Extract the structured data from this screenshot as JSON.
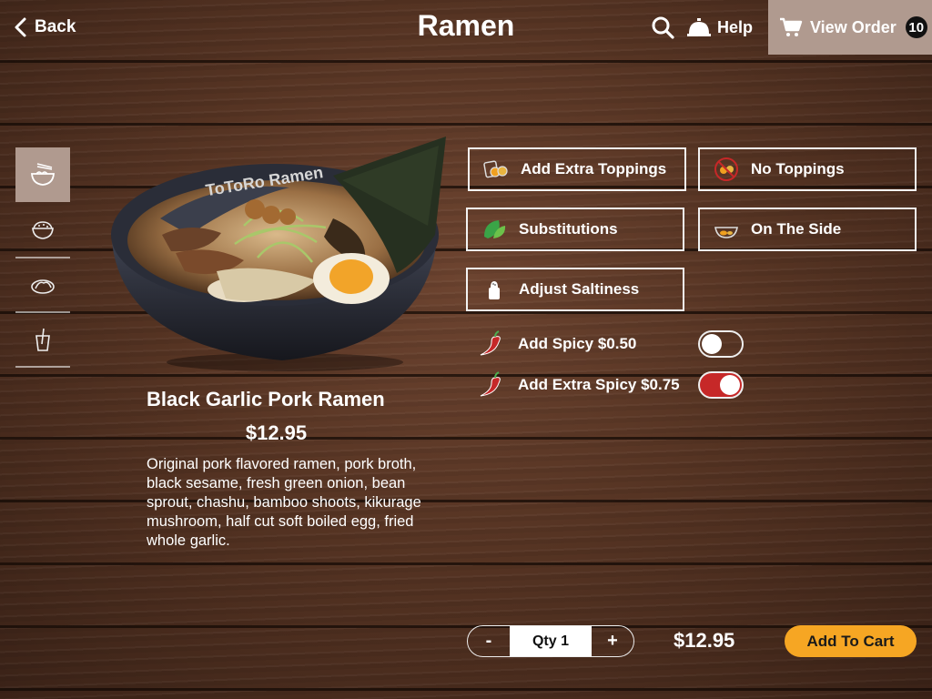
{
  "header": {
    "back_label": "Back",
    "title": "Ramen",
    "help_label": "Help",
    "view_order_label": "View Order",
    "order_count": "10"
  },
  "nav": {
    "items": [
      {
        "name": "ramen-bowl-icon",
        "active": true
      },
      {
        "name": "rice-bowl-icon",
        "active": false
      },
      {
        "name": "dumplings-icon",
        "active": false
      },
      {
        "name": "drink-cup-icon",
        "active": false
      }
    ]
  },
  "item": {
    "name": "Black Garlic Pork Ramen",
    "price": "$12.95",
    "description": "Original pork flavored ramen, pork broth, black sesame, fresh green onion, bean sprout, chashu, bamboo shoots, kikurage mushroom, half cut soft boiled egg, fried whole garlic.",
    "bowl_text": "ToToRo Ramen"
  },
  "options": {
    "add_extra_toppings": "Add Extra Toppings",
    "no_toppings": "No Toppings",
    "substitutions": "Substitutions",
    "on_the_side": "On The Side",
    "adjust_saltiness": "Adjust Saltiness"
  },
  "toggles": [
    {
      "label": "Add Spicy $0.50",
      "on": false
    },
    {
      "label": "Add Extra Spicy $0.75",
      "on": true
    }
  ],
  "footer": {
    "minus": "-",
    "qty_label": "Qty 1",
    "plus": "+",
    "total": "$12.95",
    "add_to_cart": "Add To Cart"
  },
  "colors": {
    "accent": "#f6a623",
    "active_nav": "#b09a8f",
    "toggle_on": "#c62828"
  }
}
